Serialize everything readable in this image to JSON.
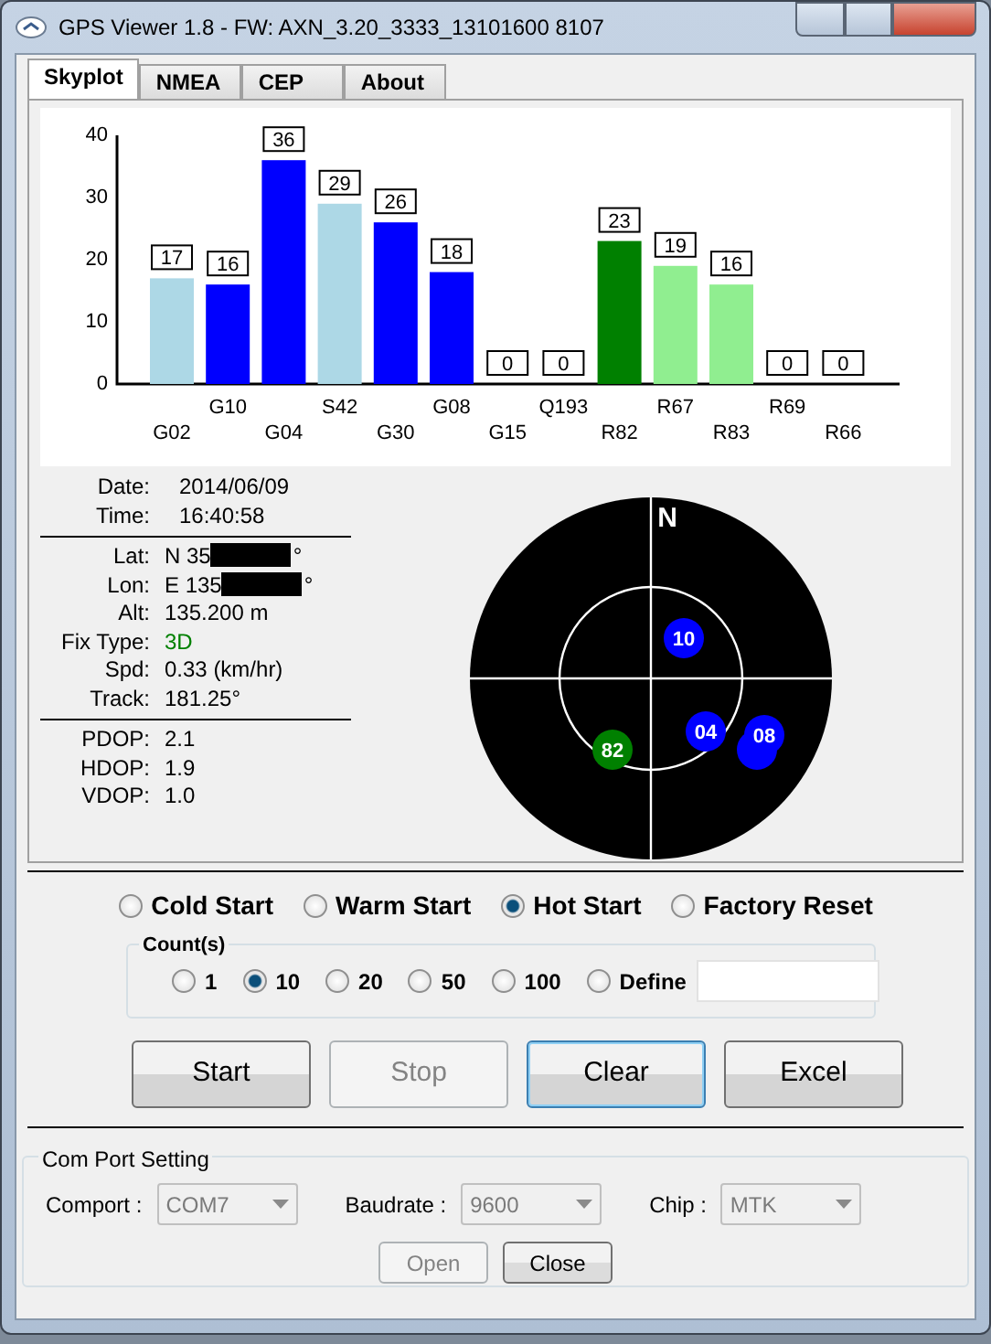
{
  "window": {
    "title": "GPS Viewer 1.8 - FW: AXN_3.20_3333_13101600 8107"
  },
  "tabs": [
    {
      "label": "Skyplot",
      "selected": true
    },
    {
      "label": "NMEA",
      "selected": false
    },
    {
      "label": "CEP",
      "selected": false
    },
    {
      "label": "About",
      "selected": false
    }
  ],
  "snr_chart": {
    "chart_data": {
      "type": "bar",
      "categories": [
        "G02",
        "G10",
        "G04",
        "S42",
        "G30",
        "G08",
        "G15",
        "Q193",
        "R82",
        "R67",
        "R83",
        "R69",
        "R66"
      ],
      "stacked": true,
      "ylim": [
        0,
        40
      ],
      "yticks": [
        0,
        10,
        20,
        30,
        40
      ],
      "data_labels": true,
      "series": [
        {
          "color": "#add8e6",
          "values": [
            17,
            null,
            null,
            29,
            null,
            null,
            null,
            null,
            null,
            null,
            null,
            null,
            null
          ]
        },
        {
          "color": "#0000ff",
          "values": [
            null,
            16,
            36,
            null,
            26,
            18,
            0,
            0,
            null,
            null,
            null,
            null,
            null
          ]
        },
        {
          "color": "#008000",
          "values": [
            null,
            null,
            null,
            null,
            null,
            null,
            null,
            null,
            23,
            null,
            null,
            null,
            null
          ]
        },
        {
          "color": "#90ee90",
          "values": [
            null,
            null,
            null,
            null,
            null,
            null,
            null,
            null,
            null,
            19,
            16,
            0,
            0
          ]
        }
      ]
    }
  },
  "info": {
    "time_rows": [
      {
        "label": "Date:",
        "value": "2014/06/09"
      },
      {
        "label": "Time:",
        "value": "16:40:58"
      }
    ],
    "position_rows": [
      {
        "label": "Lat:",
        "value": "N 35",
        "suffix": "°",
        "kind": "redacted"
      },
      {
        "label": "Lon:",
        "value": "E 135",
        "suffix": "°",
        "kind": "redacted"
      },
      {
        "label": "Alt:",
        "value": "135.200 m",
        "kind": "plain"
      },
      {
        "label": "Fix Type:",
        "value": "3D",
        "kind": "fix"
      },
      {
        "label": "Spd:",
        "value": "0.33 (km/hr)",
        "kind": "plain"
      },
      {
        "label": "Track:",
        "value": "181.25°",
        "kind": "plain"
      }
    ],
    "dop_rows": [
      {
        "label": "PDOP:",
        "value": "2.1"
      },
      {
        "label": "HDOP:",
        "value": "1.9"
      },
      {
        "label": "VDOP:",
        "value": "1.0"
      }
    ]
  },
  "skyplot": {
    "north": "N",
    "satellites": [
      {
        "label": "10",
        "color": "#0000ff"
      },
      {
        "label": "04",
        "color": "#0000ff"
      },
      {
        "color": "#0000ff"
      },
      {
        "label": "08",
        "color": "#0000ff"
      },
      {
        "label": "82",
        "color": "#008000"
      }
    ]
  },
  "start_modes": [
    {
      "label": "Cold Start",
      "selected": false
    },
    {
      "label": "Warm Start",
      "selected": false
    },
    {
      "label": "Hot Start",
      "selected": true
    },
    {
      "label": "Factory Reset",
      "selected": false
    }
  ],
  "counts": {
    "title": "Count(s)",
    "options": [
      {
        "label": "1",
        "selected": false
      },
      {
        "label": "10",
        "selected": true
      },
      {
        "label": "20",
        "selected": false
      },
      {
        "label": "50",
        "selected": false
      },
      {
        "label": "100",
        "selected": false
      },
      {
        "label": "Define",
        "selected": false
      }
    ]
  },
  "buttons": [
    {
      "label": "Start",
      "disabled": false,
      "focused": false
    },
    {
      "label": "Stop",
      "disabled": true,
      "focused": false
    },
    {
      "label": "Clear",
      "disabled": false,
      "focused": true
    },
    {
      "label": "Excel",
      "disabled": false,
      "focused": false
    }
  ],
  "com_port": {
    "title": "Com Port Setting",
    "fields": [
      {
        "label": "Comport :",
        "value": "COM7"
      },
      {
        "label": "Baudrate :",
        "value": "9600"
      },
      {
        "label": "Chip :",
        "value": "MTK"
      }
    ],
    "buttons": [
      {
        "label": "Open",
        "disabled": true
      },
      {
        "label": "Close",
        "disabled": false
      }
    ]
  }
}
